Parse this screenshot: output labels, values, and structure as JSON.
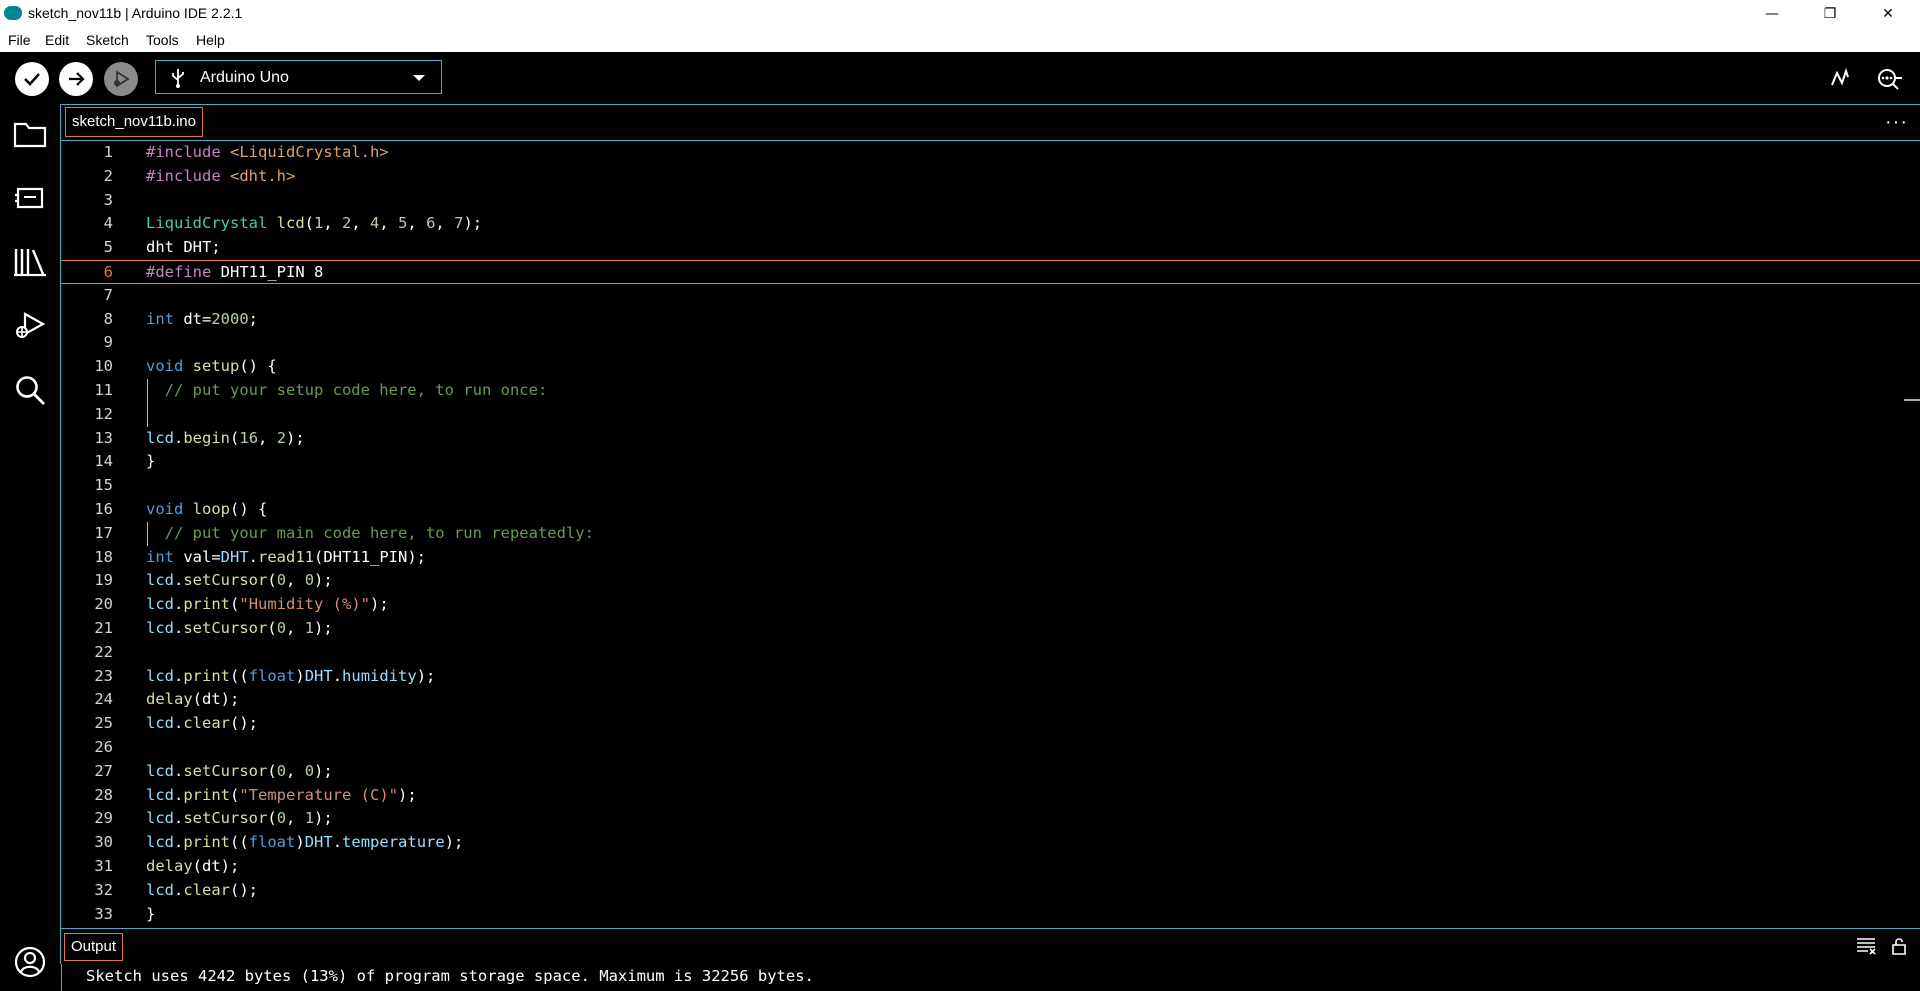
{
  "window": {
    "title": "sketch_nov11b | Arduino IDE 2.2.1",
    "controls": [
      "—",
      "❐",
      "✕"
    ]
  },
  "menu": [
    "File",
    "Edit",
    "Sketch",
    "Tools",
    "Help"
  ],
  "toolbar": {
    "board": "Arduino Uno",
    "buttons": [
      "verify",
      "upload",
      "debug"
    ],
    "right_icons": [
      "serial-plotter",
      "serial-monitor"
    ]
  },
  "sidebar": {
    "icons": [
      "sketchbook",
      "boards-manager",
      "library-manager",
      "debug",
      "search",
      "profile"
    ]
  },
  "editor": {
    "tab": "sketch_nov11b.ino",
    "active_line": 6,
    "lines": [
      {
        "n": "1",
        "t": "#include <LiquidCrystal.h>"
      },
      {
        "n": "2",
        "t": "#include <dht.h>"
      },
      {
        "n": "3",
        "t": ""
      },
      {
        "n": "4",
        "t": "LiquidCrystal lcd(1, 2, 4, 5, 6, 7);"
      },
      {
        "n": "5",
        "t": "dht DHT;"
      },
      {
        "n": "6",
        "t": "#define DHT11_PIN 8"
      },
      {
        "n": "7",
        "t": ""
      },
      {
        "n": "8",
        "t": "int dt=2000;"
      },
      {
        "n": "9",
        "t": ""
      },
      {
        "n": "10",
        "t": "void setup() {"
      },
      {
        "n": "11",
        "t": "  // put your setup code here, to run once:"
      },
      {
        "n": "12",
        "t": ""
      },
      {
        "n": "13",
        "t": "lcd.begin(16, 2);"
      },
      {
        "n": "14",
        "t": "}"
      },
      {
        "n": "15",
        "t": ""
      },
      {
        "n": "16",
        "t": "void loop() {"
      },
      {
        "n": "17",
        "t": "  // put your main code here, to run repeatedly:"
      },
      {
        "n": "18",
        "t": "int val=DHT.read11(DHT11_PIN);"
      },
      {
        "n": "19",
        "t": "lcd.setCursor(0, 0);"
      },
      {
        "n": "20",
        "t": "lcd.print(\"Humidity (%)\");"
      },
      {
        "n": "21",
        "t": "lcd.setCursor(0, 1);"
      },
      {
        "n": "22",
        "t": ""
      },
      {
        "n": "23",
        "t": "lcd.print((float)DHT.humidity);"
      },
      {
        "n": "24",
        "t": "delay(dt);"
      },
      {
        "n": "25",
        "t": "lcd.clear();"
      },
      {
        "n": "26",
        "t": ""
      },
      {
        "n": "27",
        "t": "lcd.setCursor(0, 0);"
      },
      {
        "n": "28",
        "t": "lcd.print(\"Temperature (C)\");"
      },
      {
        "n": "29",
        "t": "lcd.setCursor(0, 1);"
      },
      {
        "n": "30",
        "t": "lcd.print((float)DHT.temperature);"
      },
      {
        "n": "31",
        "t": "delay(dt);"
      },
      {
        "n": "32",
        "t": "lcd.clear();"
      },
      {
        "n": "33",
        "t": "}"
      }
    ]
  },
  "output": {
    "tab": "Output",
    "text": "Sketch uses 4242 bytes (13%) of program storage space. Maximum is 32256 bytes."
  },
  "colors": {
    "accent": "#3fb0c8",
    "active_tab": "#e07b2a"
  }
}
